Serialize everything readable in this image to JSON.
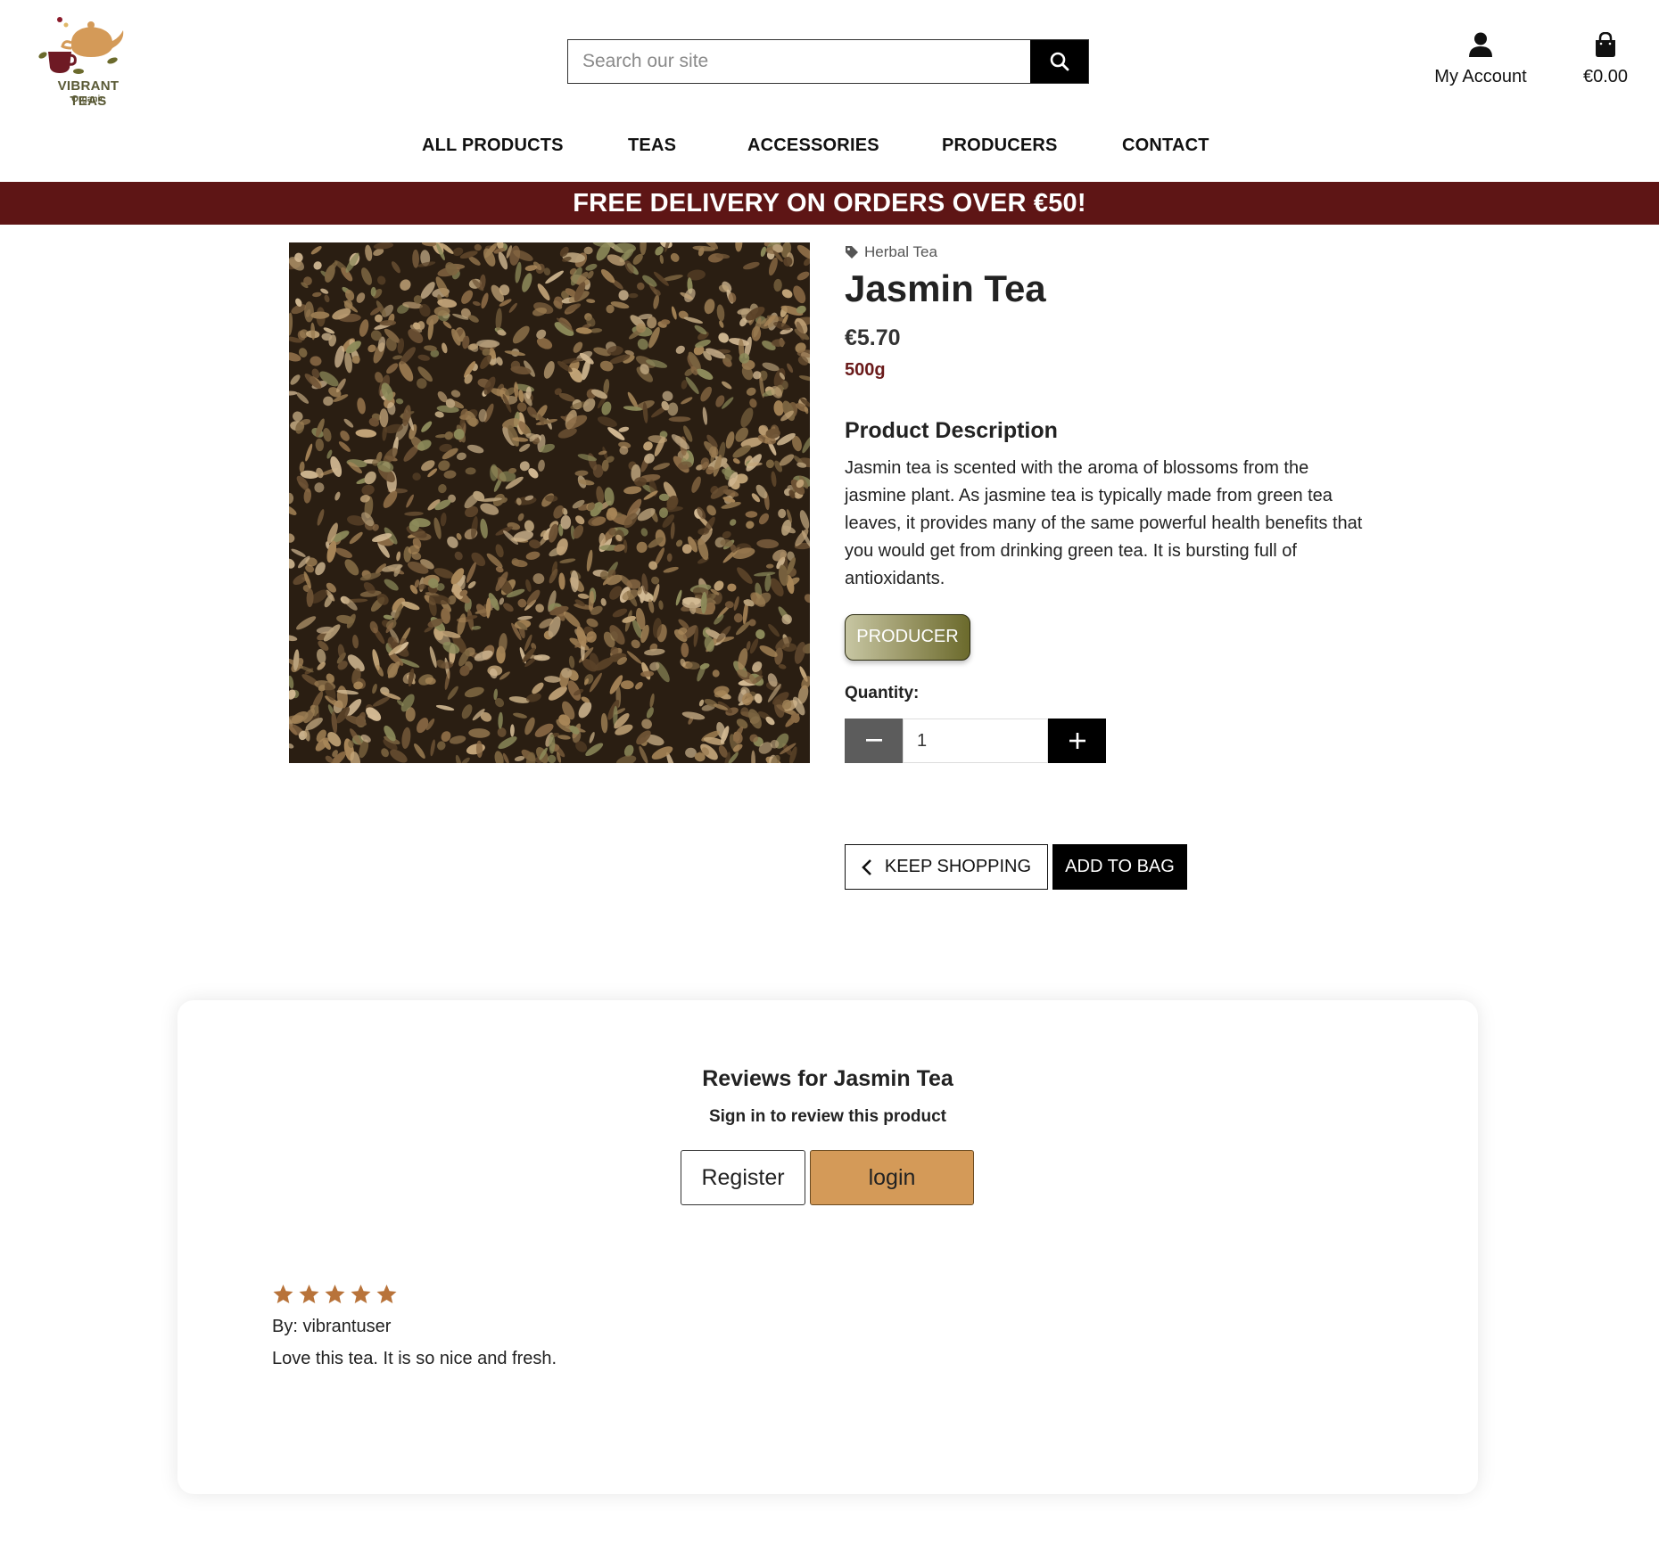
{
  "header": {
    "logo": {
      "name": "VIBRANT TEAS",
      "tagline": "Organic"
    },
    "search": {
      "placeholder": "Search our site",
      "value": "",
      "icon": "search-icon"
    },
    "account": {
      "label": "My Account",
      "icon": "user-icon"
    },
    "bag": {
      "total": "€0.00",
      "icon": "shopping-bag-icon"
    }
  },
  "nav": {
    "items": [
      {
        "label": "ALL PRODUCTS"
      },
      {
        "label": "TEAS"
      },
      {
        "label": "ACCESSORIES"
      },
      {
        "label": "PRODUCERS"
      },
      {
        "label": "CONTACT"
      }
    ]
  },
  "banner": {
    "text": "FREE DELIVERY ON ORDERS OVER €50!",
    "color": "#5e1515"
  },
  "product": {
    "category": "Herbal Tea",
    "category_icon": "tag-icon",
    "name": "Jasmin Tea",
    "price": "€5.70",
    "weight": "500g",
    "description_title": "Product Description",
    "description": "Jasmin tea is scented with the aroma of blossoms from the jasmine plant. As jasmine tea is typically made from green tea leaves, it provides many of the same powerful health benefits that you would get from drinking green tea. It is bursting full of antioxidants.",
    "producer_button": "PRODUCER",
    "quantity_label": "Quantity:",
    "quantity_value": "1",
    "keep_shopping": "KEEP SHOPPING",
    "add_to_bag": "ADD TO BAG"
  },
  "reviews": {
    "title": "Reviews for Jasmin Tea",
    "subtitle": "Sign in to review this product",
    "register_label": "Register",
    "login_label": "login",
    "login_color": "#d49a58",
    "items": [
      {
        "rating": 5,
        "author": "By: vibrantuser",
        "text": "Love this tea. It is so nice and fresh."
      }
    ]
  }
}
